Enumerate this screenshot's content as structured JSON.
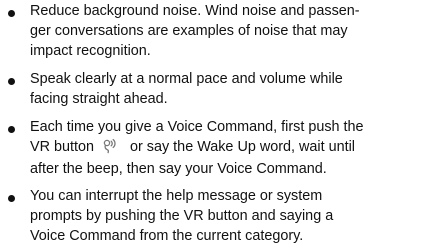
{
  "bullets": [
    {
      "lines": [
        "Reduce background noise. Wind noise and passen-",
        "ger conversations are examples of noise that may",
        "impact recognition."
      ]
    },
    {
      "lines": [
        "Speak clearly at a normal pace and volume while",
        "facing straight ahead."
      ]
    },
    {
      "lines": [
        "Each time you give a Voice Command, first push the",
        "VR button",
        "or say the Wake Up word, wait until",
        "after the beep, then say your Voice Command."
      ],
      "icon": "voice-recognition-icon"
    },
    {
      "lines": [
        "You can interrupt the help message or system",
        "prompts by pushing the VR button and saying a",
        "Voice Command from the current category."
      ]
    }
  ],
  "colors": {
    "text": "#111111",
    "icon": "#777777"
  }
}
